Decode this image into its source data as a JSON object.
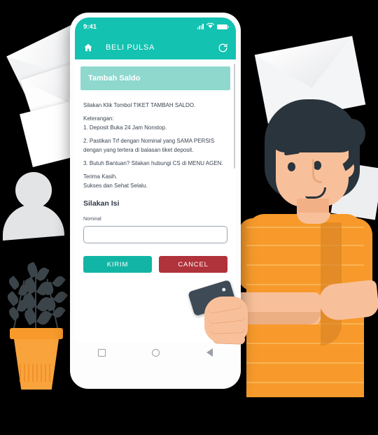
{
  "phone": {
    "status_bar": {
      "time": "9:41",
      "icons": [
        "signal-bars-icon",
        "wifi-icon",
        "battery-icon"
      ]
    },
    "app_bar": {
      "home_icon": "home-icon",
      "title": "BELI PULSA",
      "refresh_icon": "refresh-icon"
    },
    "banner": {
      "label": "Tambah Saldo"
    },
    "body": {
      "intro": "Silakan Klik Tombol TIKET TAMBAH SALDO.",
      "keterangan_label": "Keterangan:",
      "item1": "1. Deposit Buka 24 Jam Nonstop.",
      "item2": "2. Pastikan Trf dengan Nominal yang SAMA PERSIS dengan yang tertera di balasan tiket deposit.",
      "item3": "3. Butuh Bantuan? Silakan hubungi CS di MENU AGEN.",
      "thanks1": "Terima Kasih.",
      "thanks2": "Sukses dan Sehat Selalu."
    },
    "form": {
      "heading": "Silakan Isi",
      "nominal_label": "Nominal",
      "nominal_value": "",
      "nominal_placeholder": ""
    },
    "buttons": {
      "submit": "KIRIM",
      "cancel": "CANCEL"
    },
    "nav_bar": {
      "recents_icon": "square-recents-icon",
      "home_icon": "circle-home-icon",
      "back_icon": "triangle-back-icon"
    }
  },
  "colors": {
    "teal_primary": "#13c2b1",
    "teal_banner": "#8ed8ce",
    "teal_button": "#12b5a5",
    "red_button": "#b0323a",
    "background": "#000000",
    "shirt_orange": "#f79a2b",
    "hair_dark": "#2a343c",
    "skin": "#f8c09a"
  },
  "illustration": {
    "items": [
      "envelope-left-1",
      "envelope-left-2",
      "envelope-left-3",
      "avatar-silhouette",
      "potted-plant",
      "character-man",
      "envelope-right-1",
      "envelope-right-2",
      "hand-holding-phone"
    ]
  }
}
